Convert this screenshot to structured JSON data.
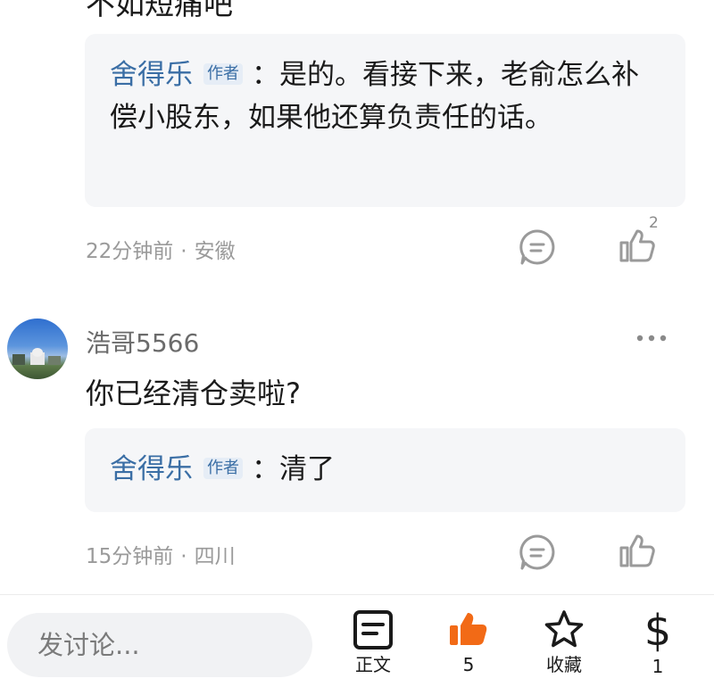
{
  "previous_comment": {
    "cut_text": "不如短痛吧"
  },
  "thread_1": {
    "reply": {
      "author": "舍得乐",
      "author_badge": "作者",
      "separator": "：",
      "text": "是的。看接下来，老俞怎么补偿小股东，如果他还算负责任的话。"
    },
    "meta": {
      "time": "22分钟前",
      "dot": "·",
      "location": "安徽"
    },
    "like_count": "2"
  },
  "thread_2": {
    "username": "浩哥5566",
    "comment": "你已经清仓卖啦?",
    "reply": {
      "author": "舍得乐",
      "author_badge": "作者",
      "separator": "：",
      "text": "清了"
    },
    "meta": {
      "time": "15分钟前",
      "dot": "·",
      "location": "四川"
    }
  },
  "bottom_bar": {
    "input_placeholder": "发讨论...",
    "article_label": "正文",
    "like_count": "5",
    "favorite_label": "收藏",
    "reward_symbol": "$",
    "reward_count": "1",
    "like_color": "#f26a16"
  }
}
